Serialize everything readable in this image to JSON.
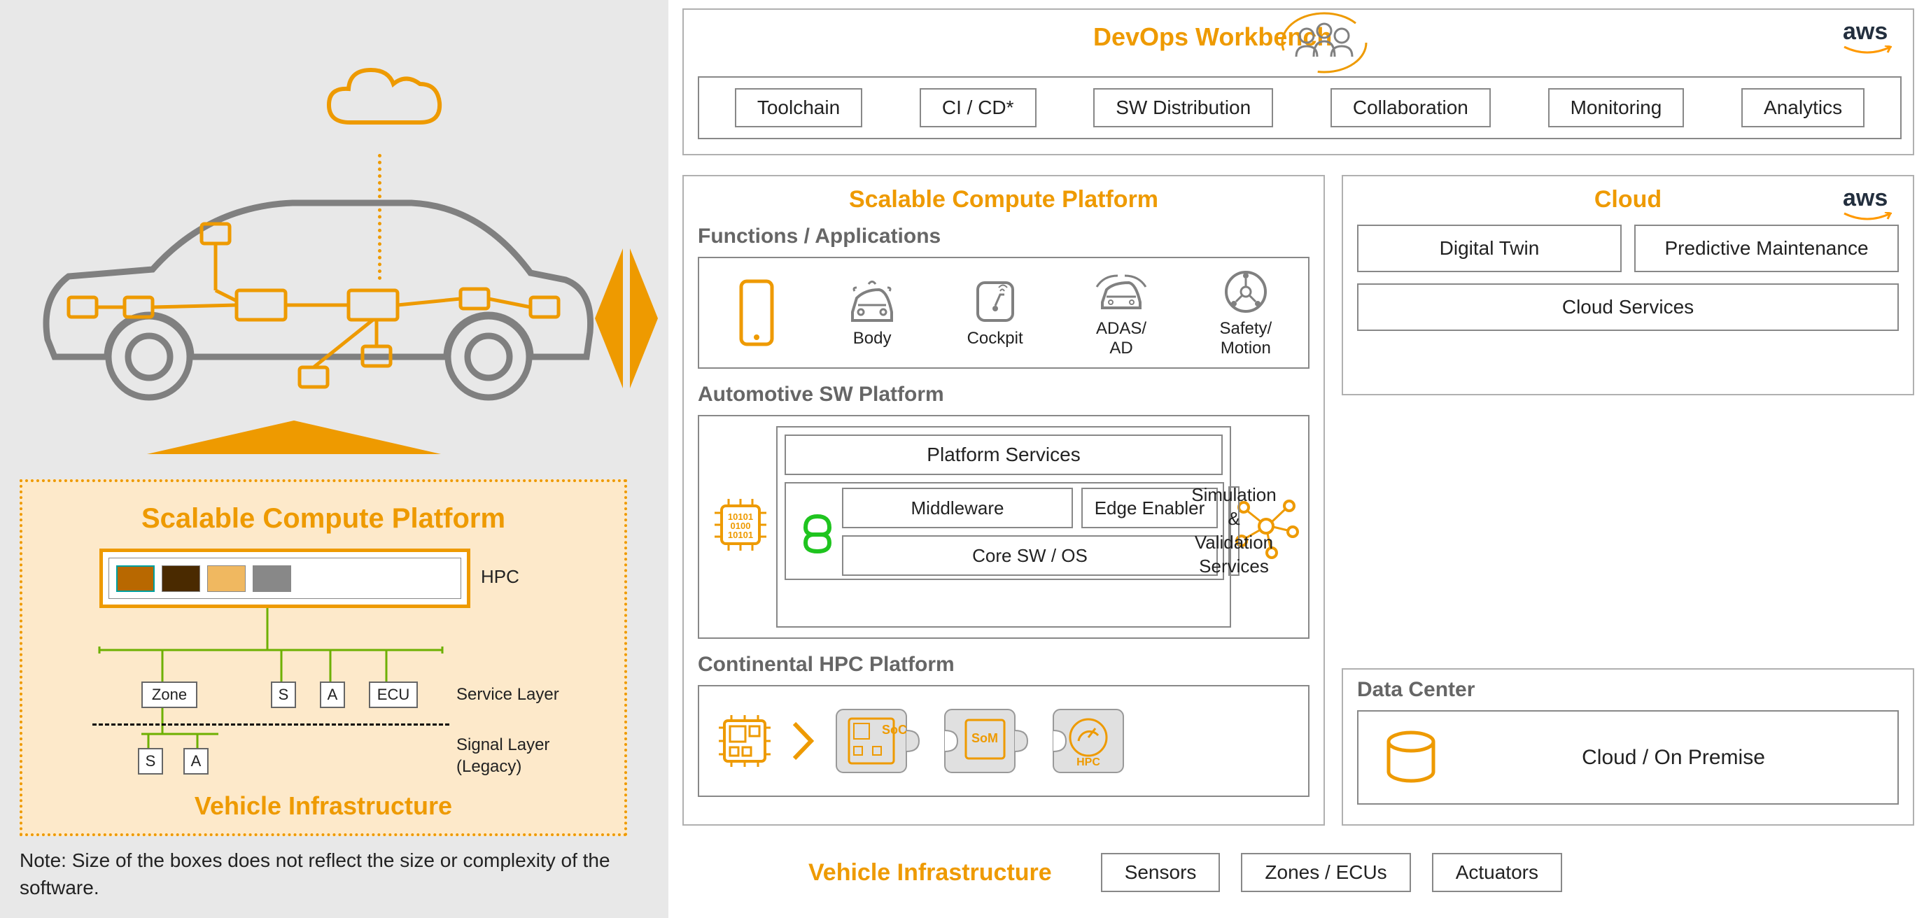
{
  "leftPanel": {
    "dottedBox": {
      "title": "Scalable Compute Platform",
      "bottomTitle": "Vehicle Infrastructure",
      "hpcLabel": "HPC",
      "zone": "Zone",
      "s": "S",
      "a": "A",
      "ecu": "ECU",
      "serviceLayer": "Service Layer",
      "signalLayer": "Signal Layer\n(Legacy)"
    },
    "note": "Note: Size of the boxes does not reflect the size or complexity of the software."
  },
  "devops": {
    "title": "DevOps Workbench",
    "aws": "aws",
    "items": [
      "Toolchain",
      "CI / CD*",
      "SW Distribution",
      "Collaboration",
      "Monitoring",
      "Analytics"
    ]
  },
  "scp": {
    "title": "Scalable Compute Platform",
    "functionsTitle": "Functions / Applications",
    "functions": [
      "Body",
      "Cockpit",
      "ADAS/\nAD",
      "Safety/\nMotion"
    ],
    "autoSwTitle": "Automotive SW Platform",
    "platformServices": "Platform Services",
    "middleware": "Middleware",
    "edgeEnabler": "Edge Enabler",
    "coreOs": "Core SW / OS",
    "simVal": "Simulation & Validation Services",
    "contHpcTitle": "Continental HPC Platform",
    "soc": "SoC",
    "som": "SoM",
    "hpc": "HPC"
  },
  "cloud": {
    "title": "Cloud",
    "aws": "aws",
    "digitalTwin": "Digital Twin",
    "predMaint": "Predictive Maintenance",
    "cloudServices": "Cloud Services"
  },
  "dataCenter": {
    "title": "Data Center",
    "label": "Cloud / On Premise"
  },
  "vehicleInfra": {
    "title": "Vehicle Infrastructure",
    "items": [
      "Sensors",
      "Zones / ECUs",
      "Actuators"
    ]
  }
}
